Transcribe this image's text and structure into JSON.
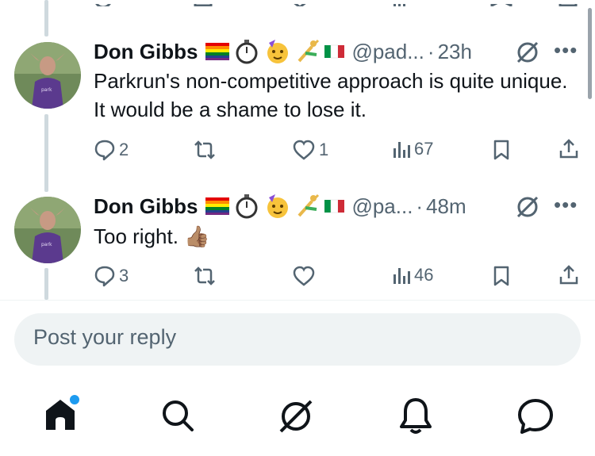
{
  "colors": {
    "text": "#0f1419",
    "secondary": "#536471",
    "accent": "#1d9bf0",
    "reply_bg": "#eff3f4",
    "thread_line": "#cfd9de"
  },
  "tweets": [
    {
      "display_name": "Don Gibbs",
      "emojis": [
        "rainbow-flag",
        "stopwatch",
        "partying-face",
        "cartwheel",
        "italy-flag"
      ],
      "handle": "@pad...",
      "separator": "·",
      "time": "23h",
      "text": "Parkrun's non-competitive approach is quite unique. It would be a shame to lose it.",
      "replies": "2",
      "reposts": "",
      "likes": "1",
      "views": "67"
    },
    {
      "display_name": "Don Gibbs",
      "emojis": [
        "rainbow-flag",
        "stopwatch",
        "partying-face",
        "cartwheel",
        "italy-flag"
      ],
      "handle": "@pa...",
      "separator": "·",
      "time": "48m",
      "text": "Too right. 👍🏽",
      "replies": "3",
      "reposts": "",
      "likes": "",
      "views": "46"
    }
  ],
  "reply": {
    "placeholder": "Post your reply"
  },
  "bottom_nav": {
    "items": [
      "home-icon",
      "search-icon",
      "grok-icon",
      "notifications-icon",
      "messages-icon"
    ],
    "home_notification_dot": true
  }
}
